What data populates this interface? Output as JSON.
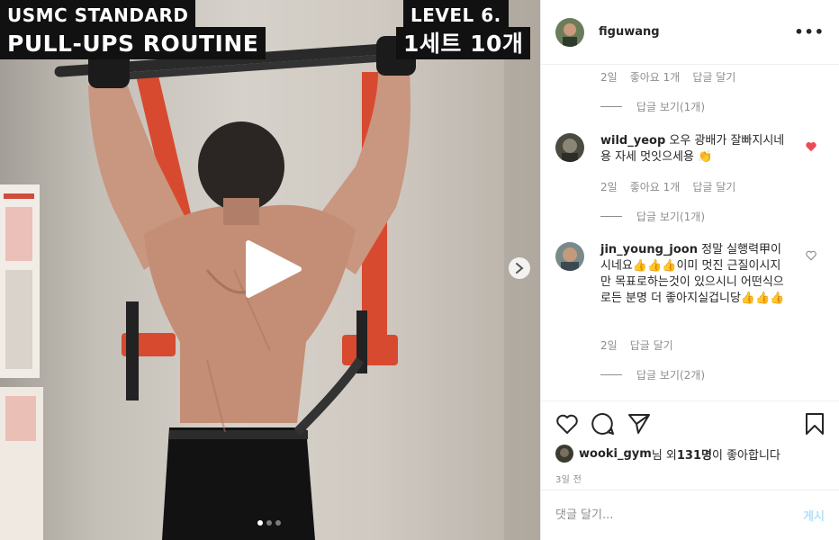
{
  "video": {
    "overlay_line1": "USMC STANDARD",
    "overlay_line2": "PULL-UPS ROUTINE",
    "overlay_level": "LEVEL 6.",
    "overlay_sets": "1세트 10개",
    "carousel_total": 3,
    "carousel_active": 1
  },
  "header": {
    "username": "figuwang",
    "more_label": "•••"
  },
  "comments": {
    "prev_meta": {
      "time": "2일",
      "likes": "좋아요 1개",
      "reply": "답글 달기"
    },
    "prev_view_replies": "답글 보기(1개)",
    "items": [
      {
        "username": "wild_yeop",
        "text": "오우 광배가 잘빠지시네용 자세 멋잇으세용 👏",
        "time": "2일",
        "likes": "좋아요 1개",
        "reply": "답글 달기",
        "view_replies": "답글 보기(1개)",
        "liked": true
      },
      {
        "username": "jin_young_joon",
        "text": "정말 실행력甲이시네요👍👍👍이미 멋진 근질이시지만 목표로하는것이 있으시니 어떤식으로든 분명 더 좋아지실겁니당👍👍👍",
        "time": "2일",
        "reply": "답글 달기",
        "view_replies": "답글 보기(2개)",
        "liked": false
      }
    ]
  },
  "likes": {
    "user": "wooki_gym",
    "mid": "님 외 ",
    "count": "131명",
    "suffix": "이 좋아합니다"
  },
  "date": "3일 전",
  "add_comment": {
    "placeholder": "댓글 달기...",
    "post_label": "게시"
  },
  "colors": {
    "heart_liked": "#ed4956",
    "post_disabled": "#b2dffc"
  }
}
